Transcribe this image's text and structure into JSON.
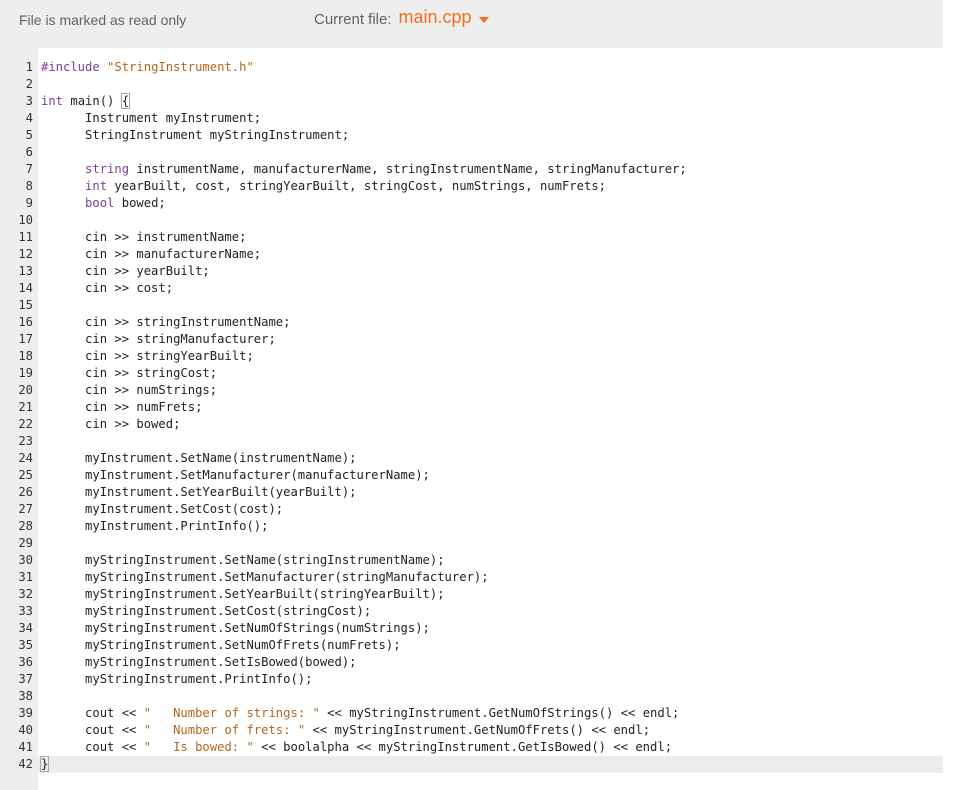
{
  "header": {
    "readonly_text": "File is marked as read only",
    "current_file_label": "Current file:",
    "filename": "main.cpp",
    "dropdown_icon": "chevron-down-icon"
  },
  "colors": {
    "accent": "#f76b1c",
    "header_bg": "#eeeeee",
    "gutter_bg": "#eeeeee"
  },
  "editor": {
    "active_line": 42,
    "lines": [
      "#include \"StringInstrument.h\"",
      "",
      "int main() {",
      "      Instrument myInstrument;",
      "      StringInstrument myStringInstrument;",
      "",
      "      string instrumentName, manufacturerName, stringInstrumentName, stringManufacturer;",
      "      int yearBuilt, cost, stringYearBuilt, stringCost, numStrings, numFrets;",
      "      bool bowed;",
      "",
      "      cin >> instrumentName;",
      "      cin >> manufacturerName;",
      "      cin >> yearBuilt;",
      "      cin >> cost;",
      "",
      "      cin >> stringInstrumentName;",
      "      cin >> stringManufacturer;",
      "      cin >> stringYearBuilt;",
      "      cin >> stringCost;",
      "      cin >> numStrings;",
      "      cin >> numFrets;",
      "      cin >> bowed;",
      "",
      "      myInstrument.SetName(instrumentName);",
      "      myInstrument.SetManufacturer(manufacturerName);",
      "      myInstrument.SetYearBuilt(yearBuilt);",
      "      myInstrument.SetCost(cost);",
      "      myInstrument.PrintInfo();",
      "",
      "      myStringInstrument.SetName(stringInstrumentName);",
      "      myStringInstrument.SetManufacturer(stringManufacturer);",
      "      myStringInstrument.SetYearBuilt(stringYearBuilt);",
      "      myStringInstrument.SetCost(stringCost);",
      "      myStringInstrument.SetNumOfStrings(numStrings);",
      "      myStringInstrument.SetNumOfFrets(numFrets);",
      "      myStringInstrument.SetIsBowed(bowed);",
      "      myStringInstrument.PrintInfo();",
      "",
      "      cout << \"   Number of strings: \" << myStringInstrument.GetNumOfStrings() << endl;",
      "      cout << \"   Number of frets: \" << myStringInstrument.GetNumOfFrets() << endl;",
      "      cout << \"   Is bowed: \" << boolalpha << myStringInstrument.GetIsBowed() << endl;",
      "}"
    ]
  }
}
